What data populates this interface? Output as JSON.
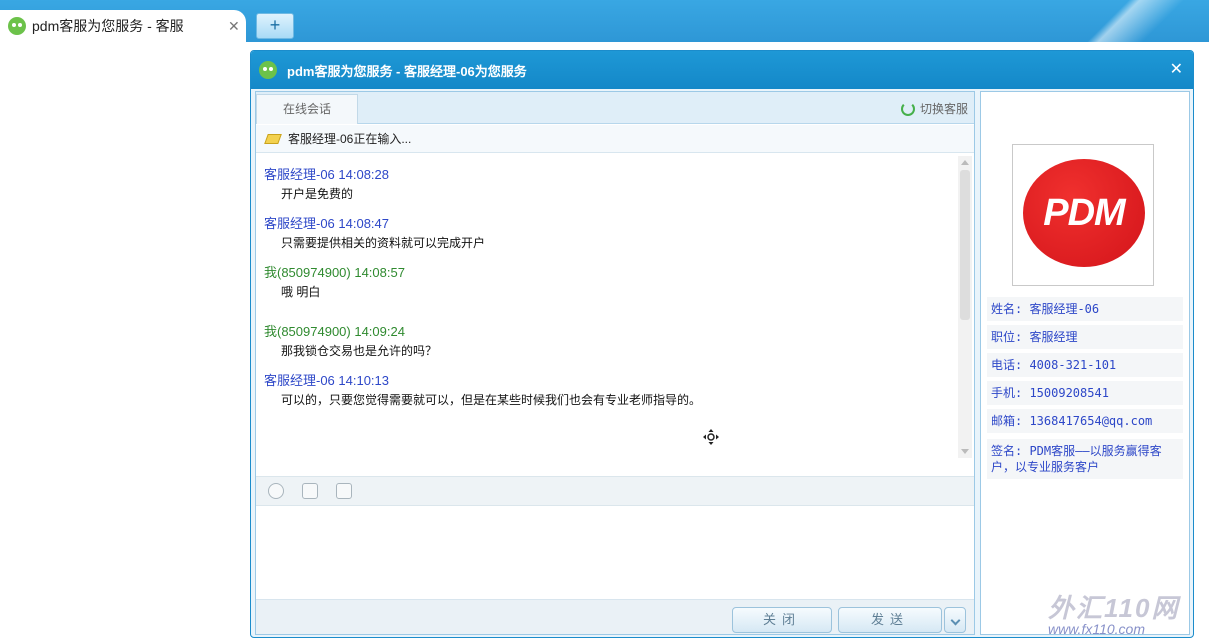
{
  "browser": {
    "tab_title": "pdm客服为您服务 - 客服",
    "tab_close": "✕",
    "new_tab": "+"
  },
  "window": {
    "title": "pdm客服为您服务 - 客服经理-06为您服务",
    "close": "✕"
  },
  "chat": {
    "tab_online": "在线会话",
    "switch_agent": "切换客服",
    "typing_status": "客服经理-06正在输入...",
    "messages": [
      {
        "sender": "客服经理-06 14:08:28",
        "type": "agent",
        "text": "开户是免费的"
      },
      {
        "sender": "客服经理-06 14:08:47",
        "type": "agent",
        "text": "只需要提供相关的资料就可以完成开户"
      },
      {
        "sender": "我(850974900) 14:08:57",
        "type": "me",
        "text": "哦 明白"
      },
      {
        "sender": "我(850974900) 14:09:24",
        "type": "me",
        "text": "那我锁仓交易也是允许的吗？"
      },
      {
        "sender": "客服经理-06 14:10:13",
        "type": "agent",
        "text": "可以的，只要您觉得需要就可以，但是在某些时候我们也会有专业老师指导的。"
      }
    ],
    "close_button": "关闭",
    "send_button": "发送"
  },
  "profile": {
    "logo_text": "PDM",
    "name": "姓名: 客服经理-06",
    "position": "职位: 客服经理",
    "phone": "电话: 4008-321-101",
    "mobile": "手机: 15009208541",
    "email": "邮箱: 1368417654@qq.com",
    "signature": "签名: PDM客服——以服务赢得客户，以专业服务客户"
  },
  "watermark": {
    "line1": "外汇110网",
    "line2": "www.fx110.com"
  }
}
